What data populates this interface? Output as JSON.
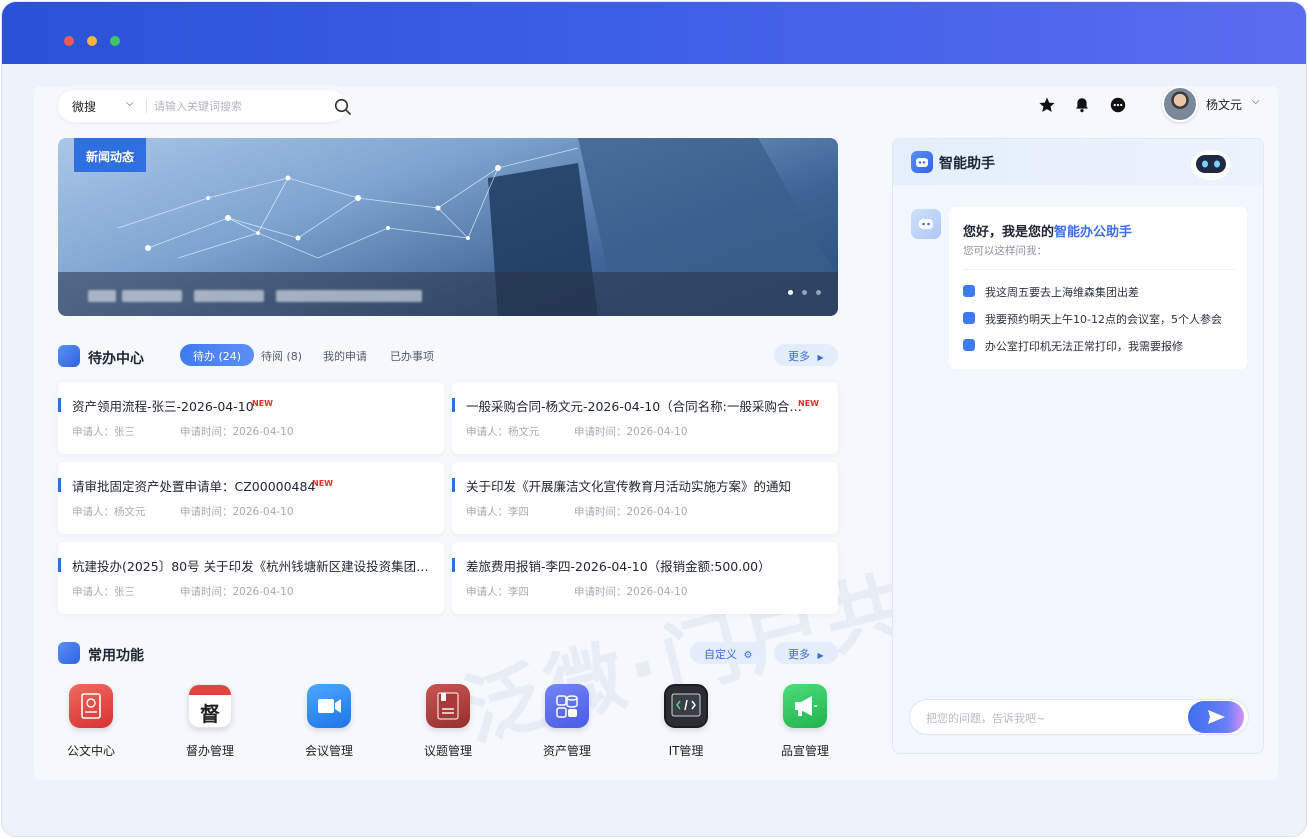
{
  "search": {
    "scope": "微搜",
    "placeholder": "请输入关键词搜索"
  },
  "user": {
    "name": "杨文元"
  },
  "banner": {
    "tag": "新闻动态"
  },
  "todo": {
    "title": "待办中心",
    "tabs": [
      "待办 (24)",
      "待阅 (8)",
      "我的申请",
      "已办事项"
    ],
    "more": "更多",
    "new_badge": "NEW",
    "items": [
      {
        "title": "资产领用流程-张三-2026-04-10",
        "applicant": "申请人：张三",
        "time": "申请时间：2026-04-10",
        "is_new": true
      },
      {
        "title": "一般采购合同-杨文元-2026-04-10（合同名称:一般采购合…",
        "applicant": "申请人：杨文元",
        "time": "申请时间：2026-04-10",
        "is_new": true
      },
      {
        "title": "请审批固定资产处置申请单：CZ00000484",
        "applicant": "申请人：杨文元",
        "time": "申请时间：2026-04-10",
        "is_new": true
      },
      {
        "title": "关于印发《开展廉洁文化宣传教育月活动实施方案》的通知",
        "applicant": "申请人：李四",
        "time": "申请时间：2026-04-10",
        "is_new": false
      },
      {
        "title": "杭建投办(2025〕80号 关于印发《杭州钱塘新区建设投资集团…",
        "applicant": "申请人：张三",
        "time": "申请时间：2026-04-10",
        "is_new": false
      },
      {
        "title": "差旅费用报销-李四-2026-04-10（报销金额:500.00）",
        "applicant": "申请人：李四",
        "time": "申请时间：2026-04-10",
        "is_new": false
      }
    ]
  },
  "functions": {
    "title": "常用功能",
    "customize": "自定义",
    "more": "更多",
    "items": [
      {
        "label": "公文中心",
        "icon": "document-center-icon",
        "color": "#e2433f"
      },
      {
        "label": "督办管理",
        "icon": "supervise-calendar-icon",
        "glyph": "督",
        "color": "#ffffff"
      },
      {
        "label": "会议管理",
        "icon": "video-meeting-icon",
        "color": "#2f8cf0"
      },
      {
        "label": "议题管理",
        "icon": "topic-book-icon",
        "color": "#b2403f"
      },
      {
        "label": "资产管理",
        "icon": "asset-database-icon",
        "color": "#5b6cf0"
      },
      {
        "label": "IT管理",
        "icon": "code-terminal-icon",
        "color": "#2a2d33"
      },
      {
        "label": "品宣管理",
        "icon": "megaphone-icon",
        "color": "#2fc25b"
      }
    ]
  },
  "assistant": {
    "title": "智能助手",
    "greeting_prefix": "您好，我是您的",
    "greeting_accent": "智能办公助手",
    "subtitle": "您可以这样问我：",
    "suggestions": [
      "我这周五要去上海维森集团出差",
      "我要预约明天上午10-12点的会议室，5个人参会",
      "办公室打印机无法正常打印，我需要报修"
    ],
    "input_placeholder": "把您的问题，告诉我吧~"
  }
}
